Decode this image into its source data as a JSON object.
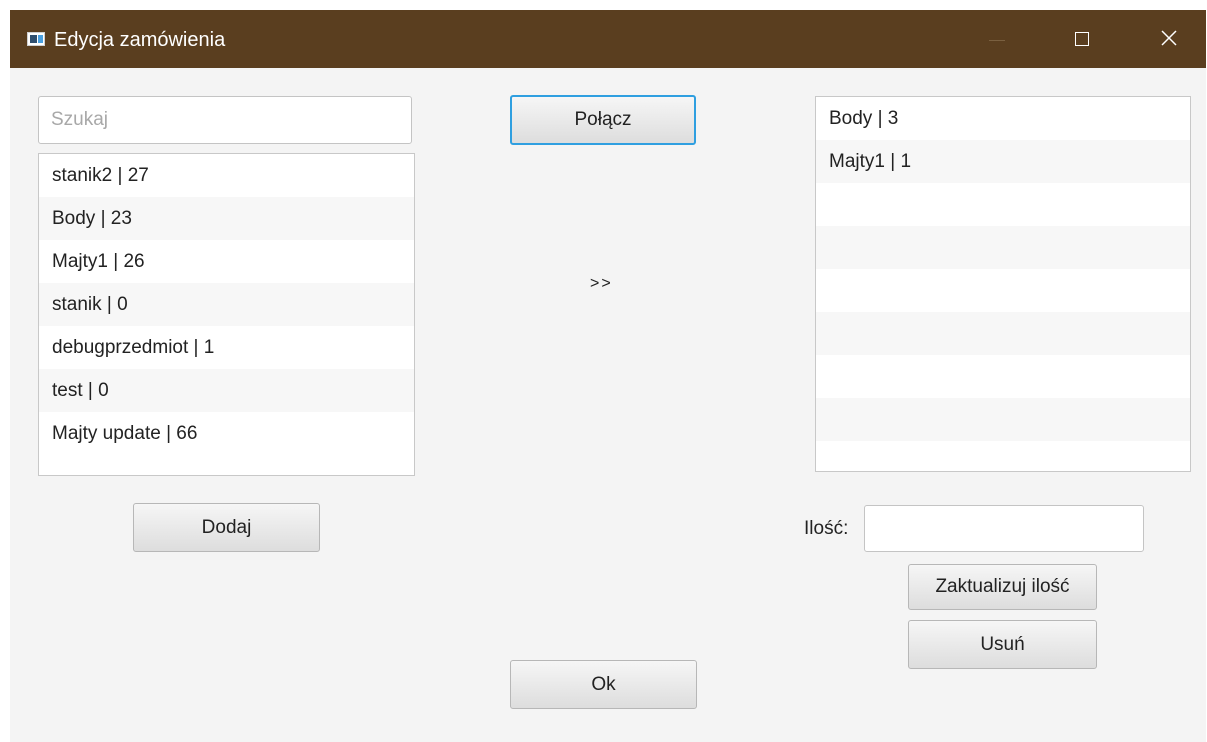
{
  "window": {
    "title": "Edycja zamówienia"
  },
  "search": {
    "placeholder": "Szukaj",
    "value": ""
  },
  "products": [
    {
      "label": "stanik2  |  27"
    },
    {
      "label": "Body  |  23"
    },
    {
      "label": "Majty1  |  26"
    },
    {
      "label": "stanik  |  0"
    },
    {
      "label": "debugprzedmiot  |  1"
    },
    {
      "label": "test  |  0"
    },
    {
      "label": "Majty update  |  66"
    }
  ],
  "order_items": [
    {
      "label": "Body  |  3"
    },
    {
      "label": "Majty1  |  1"
    }
  ],
  "buttons": {
    "polacz": "Połącz",
    "dodaj": "Dodaj",
    "ok": "Ok",
    "zaktualizuj": "Zaktualizuj ilość",
    "usun": "Usuń"
  },
  "arrow_label": ">>",
  "quantity": {
    "label": "Ilość:",
    "value": ""
  },
  "colors": {
    "titlebar": "#5a3e1f",
    "focus_border": "#2f9fe0",
    "background": "#f4f4f4"
  }
}
